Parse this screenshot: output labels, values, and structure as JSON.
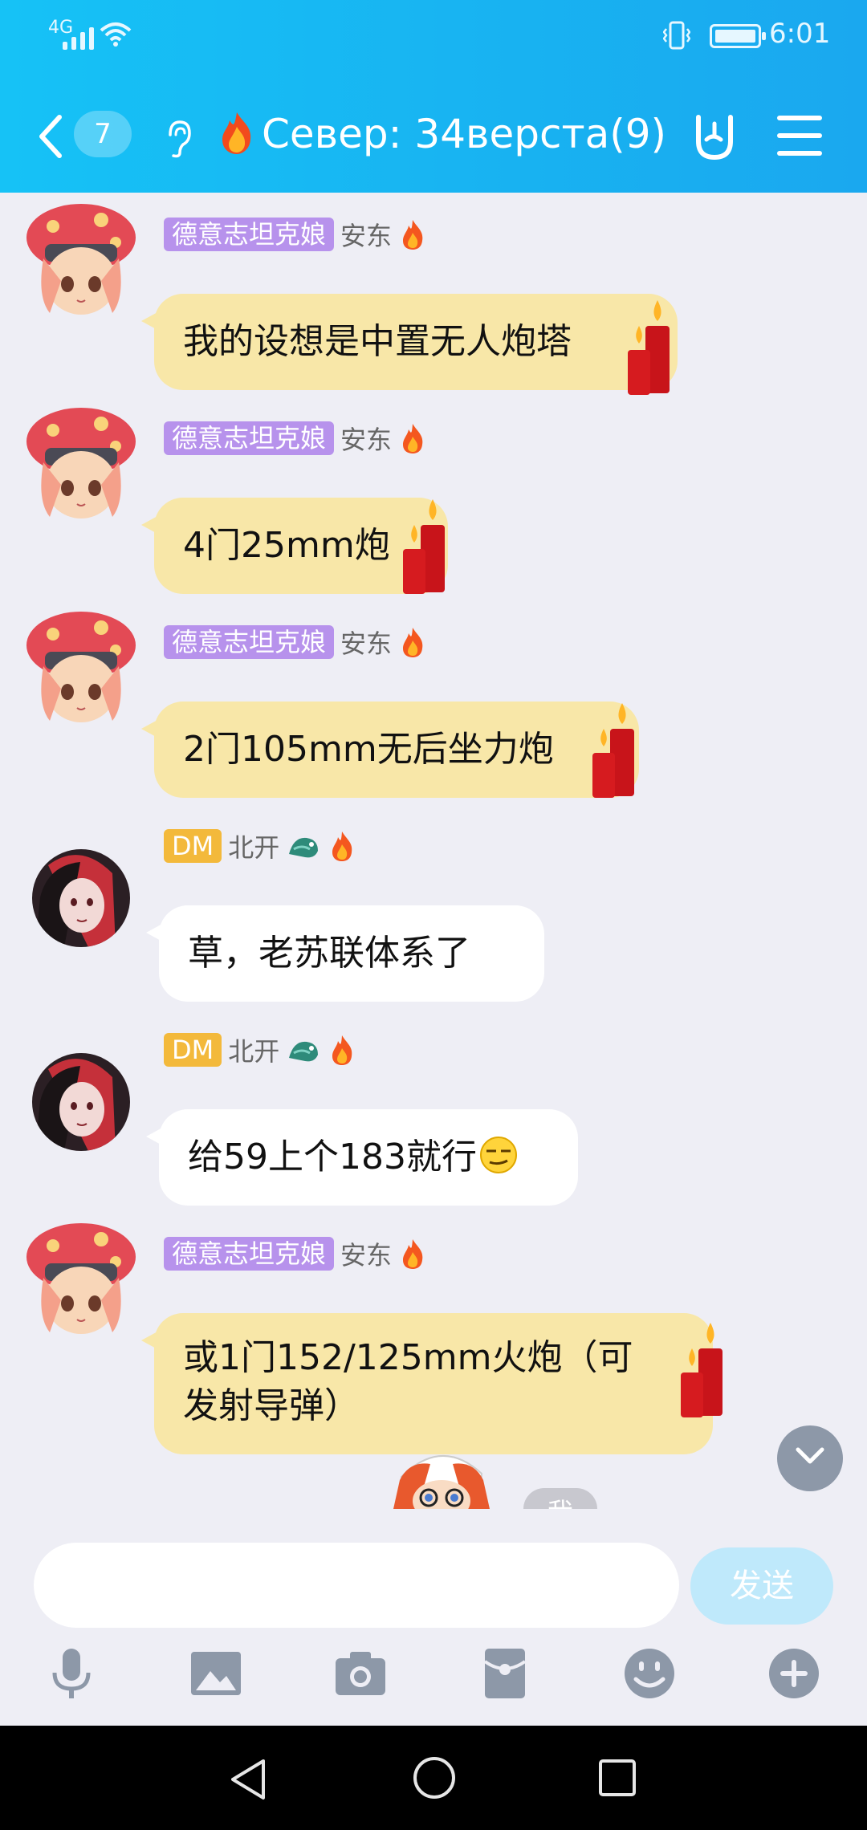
{
  "status": {
    "network": "4G",
    "time": "6:01"
  },
  "nav": {
    "unread_count": "7",
    "title": "Север: 34верста(9)"
  },
  "messages": [
    {
      "tag": "德意志坦克娘",
      "name": "安东",
      "text": "我的设想是中置无人炮塔"
    },
    {
      "tag": "德意志坦克娘",
      "name": "安东",
      "text": "4门25mm炮"
    },
    {
      "tag": "德意志坦克娘",
      "name": "安东",
      "text": "2门105mm无后坐力炮"
    },
    {
      "tag": "DM",
      "name": "北开",
      "text": "草，老苏联体系了"
    },
    {
      "tag": "DM",
      "name": "北开",
      "text": "给59上个183就行"
    },
    {
      "tag": "德意志坦克娘",
      "name": "安东",
      "text": "或1门152/125mm火炮（可发射导弹）"
    }
  ],
  "peek": {
    "label": "我"
  },
  "composer": {
    "placeholder": "",
    "send_label": "发送"
  },
  "tools": [
    "mic-icon",
    "image-icon",
    "camera-icon",
    "red-packet-icon",
    "emoji-icon",
    "plus-icon"
  ],
  "colors": {
    "header": "#18b2f1",
    "bubble_self": "#f8e7a8",
    "bubble_other": "#ffffff",
    "tag_purple": "#b792ec",
    "tag_gold": "#f3b93b"
  }
}
